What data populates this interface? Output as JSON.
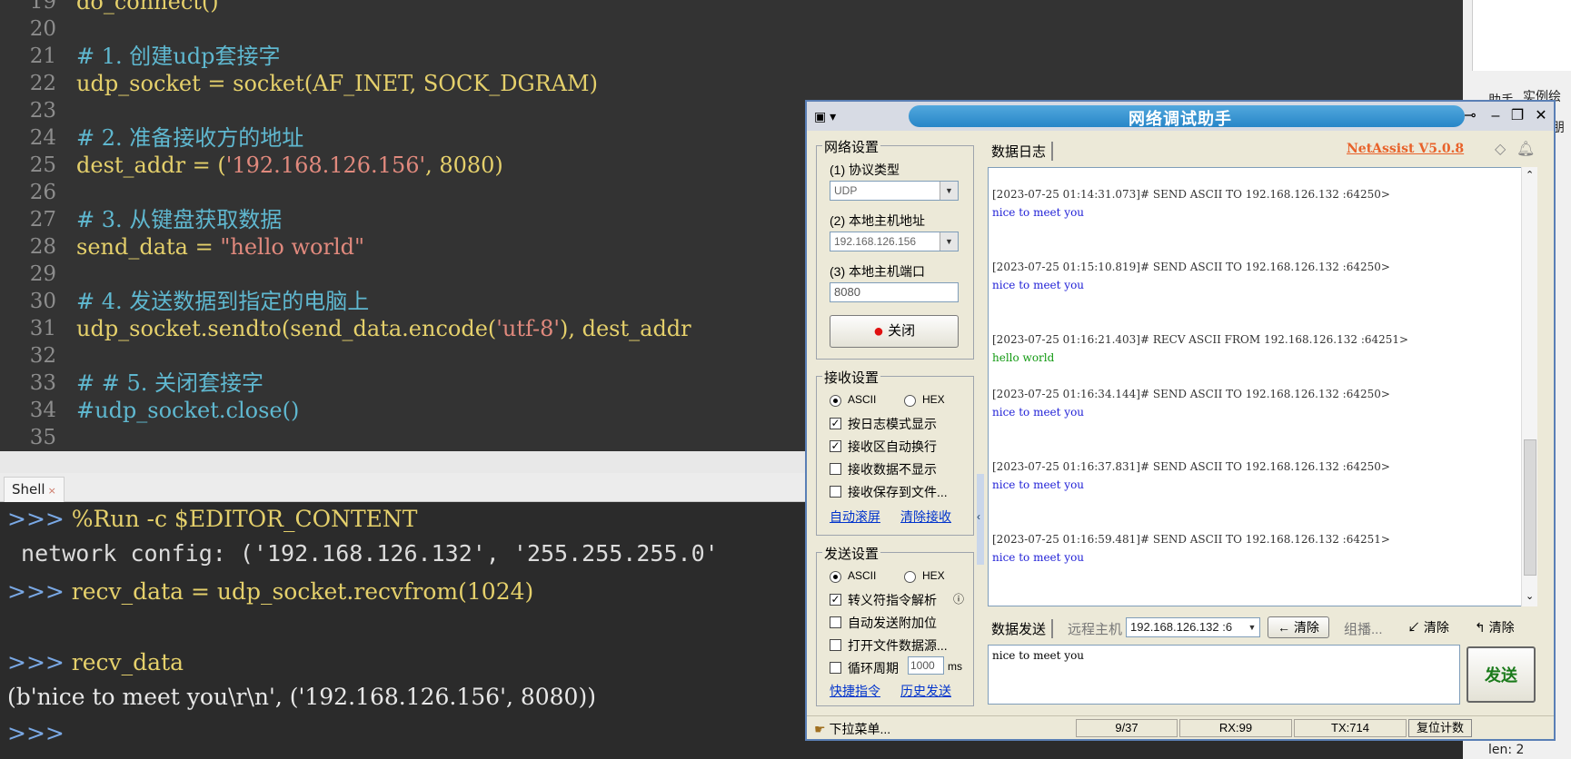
{
  "editor": {
    "lines": [
      {
        "num": "19",
        "parts": [
          {
            "t": "do_connect()",
            "c": "tok-code"
          }
        ]
      },
      {
        "num": "20",
        "parts": []
      },
      {
        "num": "21",
        "parts": [
          {
            "t": "# 1. 创建udp套接字",
            "c": "tok-comment"
          }
        ]
      },
      {
        "num": "22",
        "parts": [
          {
            "t": "udp_socket = socket(AF_INET, SOCK_DGRAM)",
            "c": "tok-code"
          }
        ]
      },
      {
        "num": "23",
        "parts": []
      },
      {
        "num": "24",
        "parts": [
          {
            "t": "# 2. 准备接收方的地址",
            "c": "tok-comment"
          }
        ]
      },
      {
        "num": "25",
        "parts": [
          {
            "t": "dest_addr = (",
            "c": "tok-code"
          },
          {
            "t": "'192.168.126.156'",
            "c": "tok-string"
          },
          {
            "t": ", 8080)",
            "c": "tok-code"
          }
        ]
      },
      {
        "num": "26",
        "parts": []
      },
      {
        "num": "27",
        "parts": [
          {
            "t": "# 3. 从键盘获取数据",
            "c": "tok-comment"
          }
        ]
      },
      {
        "num": "28",
        "parts": [
          {
            "t": "send_data = ",
            "c": "tok-code"
          },
          {
            "t": "\"hello world\"",
            "c": "tok-string"
          }
        ]
      },
      {
        "num": "29",
        "parts": []
      },
      {
        "num": "30",
        "parts": [
          {
            "t": "# 4. 发送数据到指定的电脑上",
            "c": "tok-comment"
          }
        ]
      },
      {
        "num": "31",
        "parts": [
          {
            "t": "udp_socket.sendto(send_data.encode(",
            "c": "tok-code"
          },
          {
            "t": "'utf-8'",
            "c": "tok-string"
          },
          {
            "t": "), dest_addr",
            "c": "tok-code"
          }
        ]
      },
      {
        "num": "32",
        "parts": []
      },
      {
        "num": "33",
        "parts": [
          {
            "t": "# # 5. 关闭套接字",
            "c": "tok-comment"
          }
        ]
      },
      {
        "num": "34",
        "parts": [
          {
            "t": "#udp_socket.close()",
            "c": "tok-comment"
          }
        ]
      },
      {
        "num": "35",
        "parts": []
      }
    ]
  },
  "shell": {
    "tab_label": "Shell",
    "lines": [
      {
        "prompt": ">>> ",
        "text": "%Run -c $EDITOR_CONTENT",
        "cls": "shell-cmd"
      },
      {
        "prompt": "",
        "text": " network config: ('192.168.126.132', '255.255.255.0'",
        "cls": "shell-out"
      },
      {
        "prompt": ">>> ",
        "text": "recv_data = udp_socket.recvfrom(1024)",
        "cls": "shell-cmd"
      },
      {
        "prompt": "",
        "text": "",
        "cls": "shell-out"
      },
      {
        "prompt": ">>> ",
        "text": "recv_data",
        "cls": "shell-cmd"
      },
      {
        "prompt": "",
        "text": "(b'nice to meet you\\r\\n', ('192.168.126.156', 8080))",
        "cls": "shell-res"
      },
      {
        "prompt": ">>> ",
        "text": "",
        "cls": "shell-cmd"
      }
    ]
  },
  "right_strip": {
    "texts": [
      "助手",
      "实例绘",
      "朋",
      "len: 2"
    ]
  },
  "netassist": {
    "title": "网络调试助手",
    "version": "NetAssist V5.0.8",
    "network": {
      "group": "网络设置",
      "protocol_label": "(1) 协议类型",
      "protocol_value": "UDP",
      "host_label": "(2) 本地主机地址",
      "host_value": "192.168.126.156",
      "port_label": "(3) 本地主机端口",
      "port_value": "8080",
      "close_button": "关闭"
    },
    "recv": {
      "group": "接收设置",
      "ascii": "ASCII",
      "hex": "HEX",
      "opt1": "按日志模式显示",
      "opt2": "接收区自动换行",
      "opt3": "接收数据不显示",
      "opt4": "接收保存到文件...",
      "link_autoscroll": "自动滚屏",
      "link_clear": "清除接收"
    },
    "send": {
      "group": "发送设置",
      "ascii": "ASCII",
      "hex": "HEX",
      "opt1": "转义符指令解析",
      "opt2": "自动发送附加位",
      "opt3": "打开文件数据源...",
      "opt4": "循环周期",
      "period": "1000",
      "period_unit": "ms",
      "link_shortcut": "快捷指令",
      "link_history": "历史发送"
    },
    "log_tab": "数据日志",
    "log": [
      {
        "head": "[2023-07-25 01:14:31.073]# SEND ASCII TO 192.168.126.132 :64250>",
        "body": "nice to meet you",
        "type": "log-send"
      },
      {
        "head": "[2023-07-25 01:15:10.819]# SEND ASCII TO 192.168.126.132 :64250>",
        "body": "nice to meet you",
        "type": "log-send"
      },
      {
        "head": "[2023-07-25 01:16:21.403]# RECV ASCII FROM 192.168.126.132 :64251>",
        "body": "hello world",
        "type": "log-recv"
      },
      {
        "head": "[2023-07-25 01:16:34.144]# SEND ASCII TO 192.168.126.132 :64250>",
        "body": "nice to meet you",
        "type": "log-send"
      },
      {
        "head": "[2023-07-25 01:16:37.831]# SEND ASCII TO 192.168.126.132 :64250>",
        "body": "nice to meet you",
        "type": "log-send"
      },
      {
        "head": "[2023-07-25 01:16:59.481]# SEND ASCII TO 192.168.126.132 :64251>",
        "body": "nice to meet you",
        "type": "log-send"
      }
    ],
    "sendbar": {
      "tab": "数据发送",
      "remote_label": "远程主机",
      "remote_value": "192.168.126.132 :6",
      "clear1": "清除",
      "group_label": "组播...",
      "clear2": "清除",
      "clear3": "清除"
    },
    "send_text": "nice to meet you",
    "send_button": "发送",
    "status": {
      "menu": "下拉菜单...",
      "count": "9/37",
      "rx": "RX:99",
      "tx": "TX:714",
      "reset": "复位计数"
    }
  },
  "colors": {
    "send": "#1f1fd6",
    "recv": "#119911",
    "version": "#e8622a",
    "send_button_text": "#1a7a1a"
  }
}
